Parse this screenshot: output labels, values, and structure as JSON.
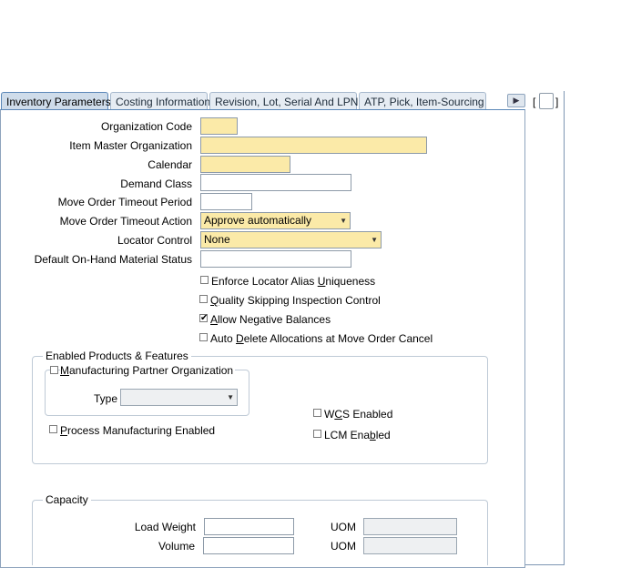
{
  "tabs": [
    {
      "label": "Inventory Parameters",
      "active": true
    },
    {
      "label": "Costing Information"
    },
    {
      "label": "Revision, Lot, Serial And LPN"
    },
    {
      "label": "ATP, Pick, Item-Sourcing"
    }
  ],
  "tab_scroll_icon": "scroll-right-icon",
  "side_bracket_left": "[",
  "side_bracket_right": "]",
  "form": {
    "organization_code": {
      "label": "Organization Code",
      "value": ""
    },
    "item_master_org": {
      "label": "Item Master Organization",
      "value": ""
    },
    "calendar": {
      "label": "Calendar",
      "value": ""
    },
    "demand_class": {
      "label": "Demand Class",
      "value": ""
    },
    "move_order_timeout_period": {
      "label": "Move Order Timeout Period",
      "value": ""
    },
    "move_order_timeout_action": {
      "label": "Move Order Timeout Action",
      "value": "Approve automatically"
    },
    "locator_control": {
      "label": "Locator Control",
      "value": "None"
    },
    "default_onhand_status": {
      "label": "Default On-Hand Material Status",
      "value": ""
    }
  },
  "checkboxes": {
    "enforce_locator_alias": {
      "pre": "Enforce Locator Alias ",
      "u": "U",
      "post": "niqueness",
      "checked": false
    },
    "quality_skipping": {
      "pre": "",
      "u": "Q",
      "post": "uality Skipping Inspection Control",
      "checked": false
    },
    "allow_negative": {
      "pre": "",
      "u": "A",
      "post": "llow Negative Balances",
      "checked": true
    },
    "auto_delete": {
      "pre": "Auto ",
      "u": "D",
      "post": "elete Allocations at Move Order Cancel",
      "checked": false
    }
  },
  "enabled_products": {
    "title": "Enabled Products & Features",
    "mfg_partner": {
      "pre": "",
      "u": "M",
      "post": "anufacturing Partner Organization",
      "checked": false
    },
    "type_label": "Type",
    "type_value": "",
    "process_mfg": {
      "pre": "",
      "u": "P",
      "post": "rocess Manufacturing Enabled",
      "checked": false
    },
    "wcs": {
      "pre": "W",
      "u": "C",
      "post": "S Enabled",
      "checked": false
    },
    "lcm": {
      "pre": "LCM Ena",
      "u": "b",
      "post": "led",
      "checked": false
    }
  },
  "capacity": {
    "title": "Capacity",
    "load_weight_label": "Load Weight",
    "load_weight_value": "",
    "volume_label": "Volume",
    "volume_value": "",
    "uom_label": "UOM",
    "weight_uom": "",
    "volume_uom": ""
  },
  "colors": {
    "required": "#fbeaa8",
    "tab_active": "#cfdcea",
    "border": "#8ea4bd"
  }
}
